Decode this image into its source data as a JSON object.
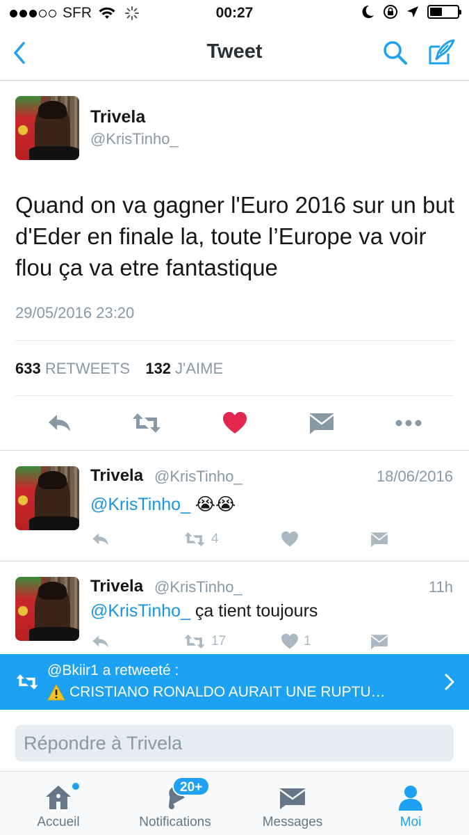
{
  "status_bar": {
    "carrier": "SFR",
    "time": "00:27"
  },
  "nav": {
    "title": "Tweet"
  },
  "main_tweet": {
    "name": "Trivela",
    "handle": "@KrisTinho_",
    "text": "Quand on va gagner l'Euro 2016 sur un but d'Eder en finale la, toute l’Europe va voir flou ça va etre fantastique",
    "date": "29/05/2016 23:20",
    "retweets_count": "633",
    "retweets_label": "RETWEETS",
    "likes_count": "132",
    "likes_label": "J'AIME",
    "liked": true,
    "like_color": "#e2264d"
  },
  "replies": [
    {
      "name": "Trivela",
      "handle": "@KrisTinho_",
      "date": "18/06/2016",
      "mention": "@KrisTinho_",
      "text": " 😭😭",
      "retweets": "4",
      "likes": ""
    },
    {
      "name": "Trivela",
      "handle": "@KrisTinho_",
      "date": "11h",
      "mention": "@KrisTinho_",
      "text": " ça tient toujours",
      "retweets": "17",
      "likes": "1"
    }
  ],
  "retweet_banner": {
    "line1": "@Bkiir1 a retweeté :",
    "line2": "CRISTIANO RONALDO AURAIT UNE RUPTU…",
    "warning_icon": "warning-icon"
  },
  "reply_box": {
    "placeholder": "Répondre à Trivela"
  },
  "tabs": [
    {
      "label": "Accueil",
      "icon": "home-icon"
    },
    {
      "label": "Notifications",
      "icon": "bell-icon"
    },
    {
      "label": "Messages",
      "icon": "envelope-icon"
    },
    {
      "label": "Moi",
      "icon": "person-icon"
    }
  ],
  "notifications_badge": "20+",
  "colors": {
    "accent": "#1da1f2",
    "secondary_text": "#8899a6",
    "mention": "#1b95e0"
  }
}
